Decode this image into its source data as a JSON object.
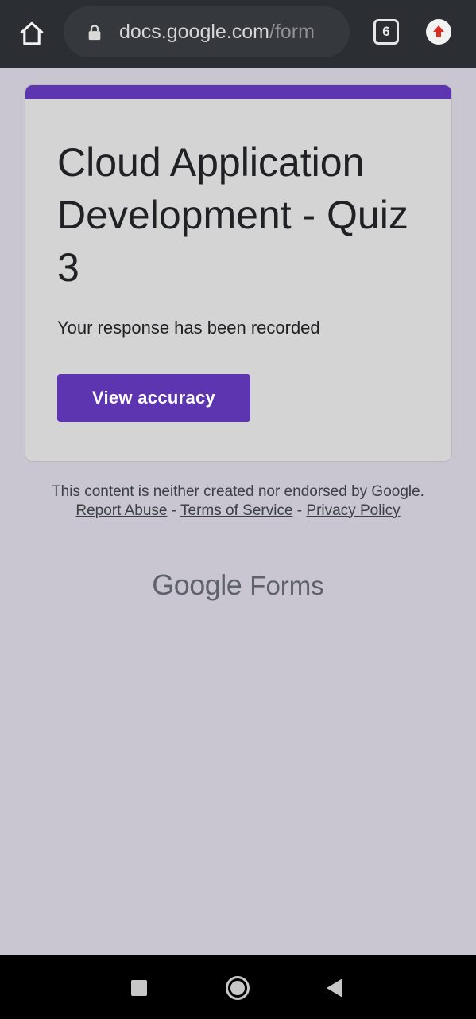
{
  "browser": {
    "url_host": "docs.google.com",
    "url_path": "/form",
    "tab_count": "6",
    "icons": {
      "home": "home-icon",
      "lock": "lock-icon",
      "tabs": "tab-switcher-icon",
      "update": "update-arrow-icon"
    },
    "toolbar_color": "#2b2e32"
  },
  "form": {
    "title": "Cloud Application Development - Quiz 3",
    "confirmation": "Your response has been recorded",
    "view_button_label": "View accuracy",
    "accent_color": "#5e35b1"
  },
  "footer": {
    "disclaimer_prefix": "This content is neither created nor endorsed by Google.",
    "report_abuse": "Report Abuse",
    "separator_1": " - ",
    "terms": "Terms of Service",
    "separator_2": " - ",
    "privacy": "Privacy Policy",
    "brand_google": "Google",
    "brand_product": "Forms"
  },
  "system_nav": {
    "icons": [
      "recent-apps-icon",
      "home-circle-icon",
      "back-triangle-icon"
    ]
  }
}
